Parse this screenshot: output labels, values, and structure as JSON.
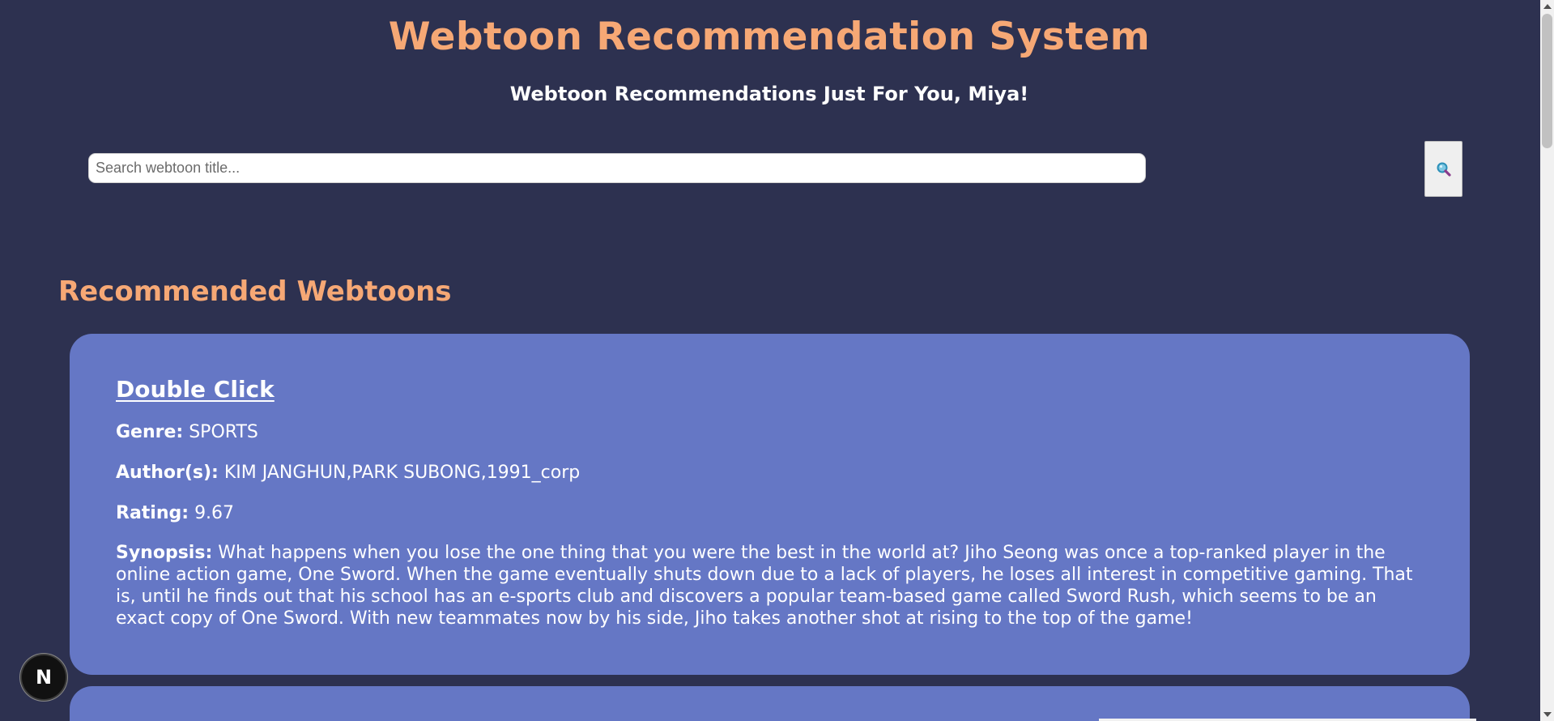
{
  "header": {
    "title": "Webtoon Recommendation System",
    "welcome": "Webtoon Recommendations Just For You, Miya!"
  },
  "search": {
    "placeholder": "Search webtoon title...",
    "value": "",
    "button_icon": "magnifier-icon"
  },
  "recommendations": {
    "heading": "Recommended Webtoons",
    "items": [
      {
        "title": "Double Click",
        "genre_label": "Genre:",
        "genre": "SPORTS",
        "authors_label": "Author(s):",
        "authors": "KIM JANGHUN,PARK SUBONG,1991_corp",
        "rating_label": "Rating:",
        "rating": "9.67",
        "synopsis_label": "Synopsis:",
        "synopsis": "What happens when you lose the one thing that you were the best in the world at? Jiho Seong was once a top-ranked player in the online action game, One Sword. When the game eventually shuts down due to a lack of players, he loses all interest in competitive gaming. That is, until he finds out that his school has an e-sports club and discovers a popular team-based game called Sword Rush, which seems to be an exact copy of One Sword. With new teammates now by his side, Jiho takes another shot at rising to the top of the game!"
      }
    ]
  },
  "dev_badge": {
    "letter": "N",
    "icon": "nextjs-icon"
  },
  "colors": {
    "background": "#2d3150",
    "accent": "#f6a875",
    "card": "#6577c5",
    "text": "#ffffff"
  }
}
